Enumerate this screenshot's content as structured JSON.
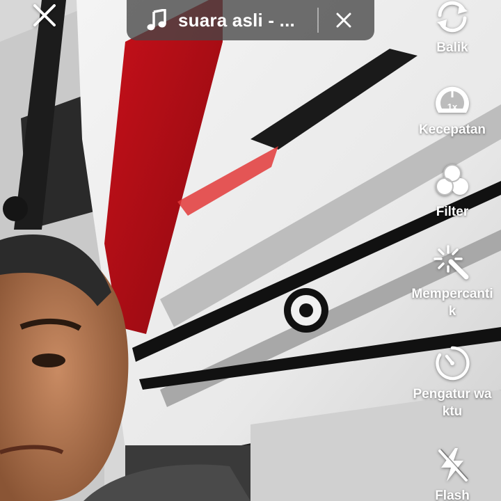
{
  "top_bar": {
    "sound_title": "suara asli - ..."
  },
  "tools": [
    {
      "id": "flip",
      "label": "Balik",
      "icon": "flip-camera-icon"
    },
    {
      "id": "speed",
      "label": "Kecepatan",
      "icon": "speed-gauge-icon",
      "badge": "1x"
    },
    {
      "id": "filter",
      "label": "Filter",
      "icon": "filter-icon"
    },
    {
      "id": "beautify",
      "label": "Mempercantik",
      "icon": "magic-wand-icon"
    },
    {
      "id": "timer",
      "label": "Pengatur waktu",
      "icon": "timer-icon"
    },
    {
      "id": "flash",
      "label": "Flash",
      "icon": "flash-off-icon"
    }
  ],
  "colors": {
    "pill_background": "#464646",
    "icon": "#ffffff"
  }
}
